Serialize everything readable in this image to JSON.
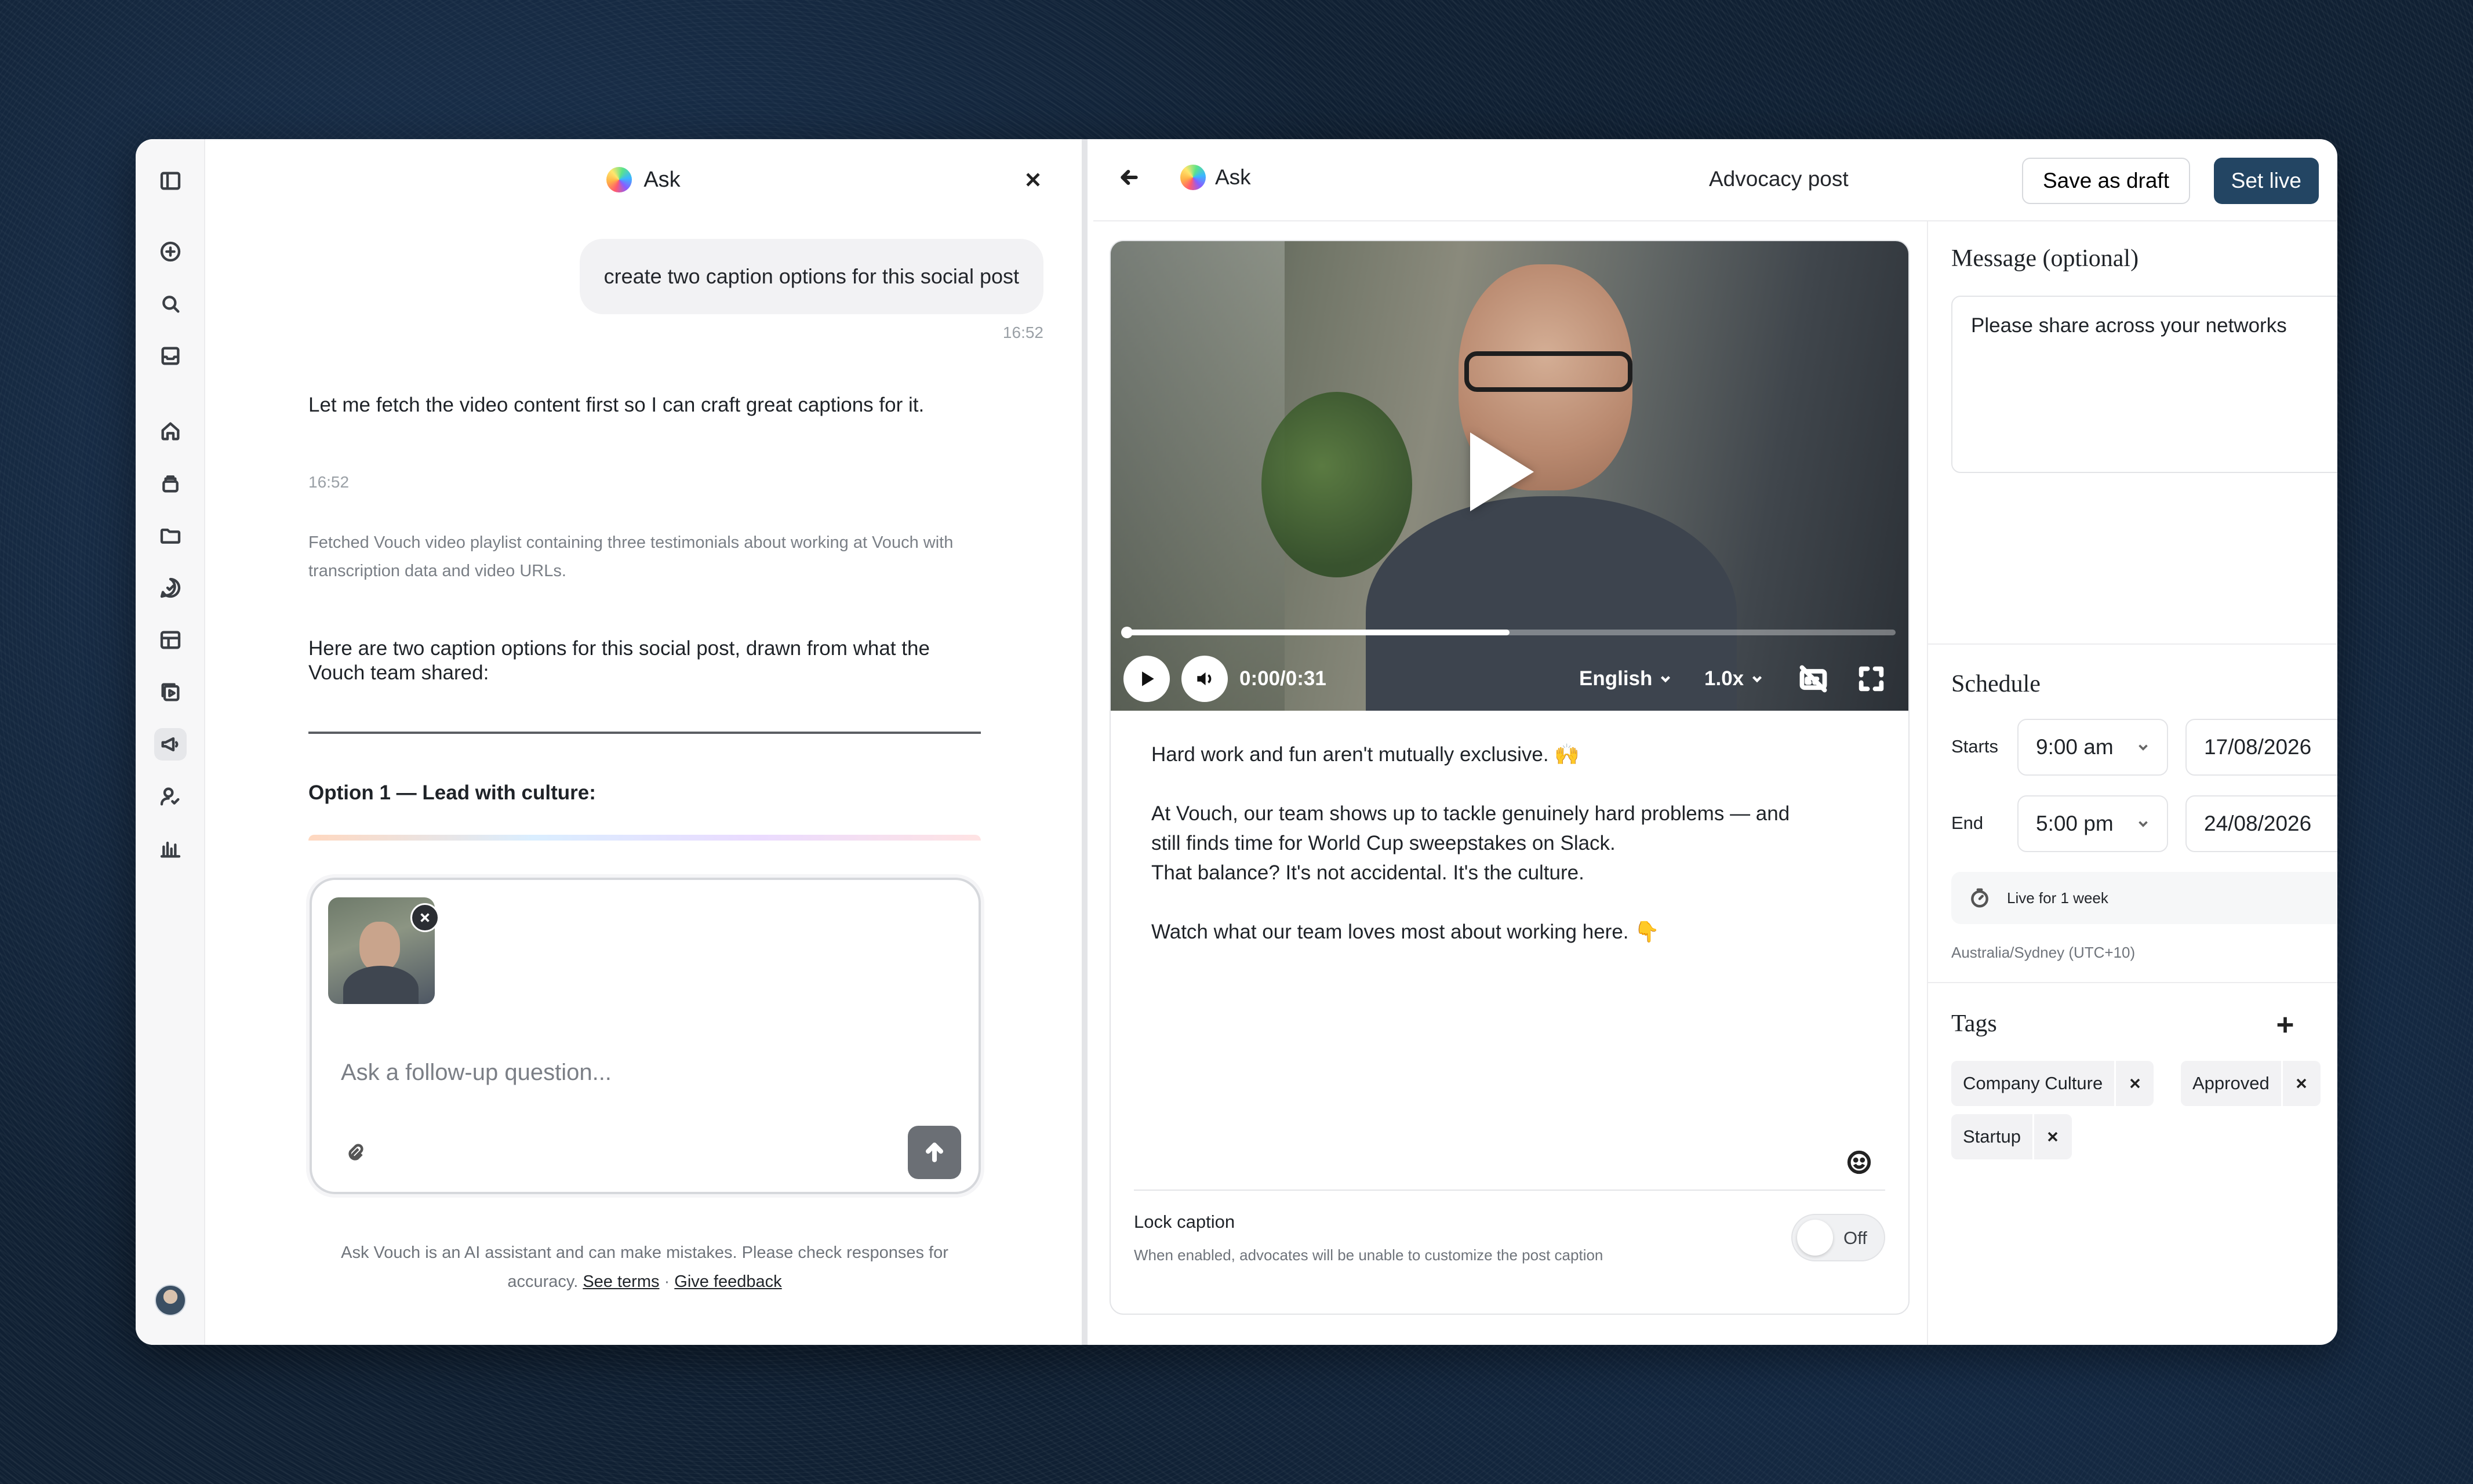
{
  "ask_panel": {
    "title": "Ask",
    "user_message": "create two caption options for this social post",
    "user_time": "16:52",
    "assistant_intro": "Let me fetch the video content first so I can craft great captions for it.",
    "assistant_time": "16:52",
    "tool_result": "Fetched Vouch video playlist containing three testimonials about working at Vouch with transcription data and video URLs.",
    "assistant_reply": "Here are two caption options for this social post, drawn from what the Vouch team shared:",
    "option_title": "Option 1 — Lead with culture:",
    "composer_placeholder": "Ask a follow-up question...",
    "disclaimer_text": "Ask Vouch is an AI assistant and can make mistakes. Please check responses for accuracy.",
    "terms_link": "See terms",
    "separator": "·",
    "feedback_link": "Give feedback"
  },
  "editor": {
    "ask_label": "Ask",
    "title": "Advocacy post",
    "save_draft": "Save as draft",
    "set_live": "Set live",
    "video": {
      "time": "0:00/0:31",
      "language": "English",
      "speed": "1.0x",
      "progress": 0.5
    },
    "caption_lines": [
      "Hard work and fun aren't mutually exclusive. 🙌",
      "",
      "At Vouch, our team shows up to tackle genuinely hard problems — and",
      "still finds time for World Cup sweepstakes on Slack.",
      "That balance? It's not accidental. It's the culture.",
      "",
      "Watch what our team loves most about working here. 👇"
    ],
    "lock_caption": {
      "title": "Lock caption",
      "description": "When enabled, advocates will be unable to customize the post caption",
      "toggle_label": "Off"
    }
  },
  "settings": {
    "message_title": "Message (optional)",
    "message_value": "Please share across your networks",
    "schedule_title": "Schedule",
    "starts_label": "Starts",
    "start_time": "9:00 am",
    "start_date": "17/08/2026",
    "end_label": "End",
    "end_time": "5:00 pm",
    "end_date": "24/08/2026",
    "duration": "Live for 1 week",
    "timezone": "Australia/Sydney (UTC+10)",
    "tags_title": "Tags",
    "tags": [
      "Company Culture",
      "Approved",
      "Startup"
    ]
  },
  "colors": {
    "primary_button": "#234563",
    "background": "#102033"
  }
}
